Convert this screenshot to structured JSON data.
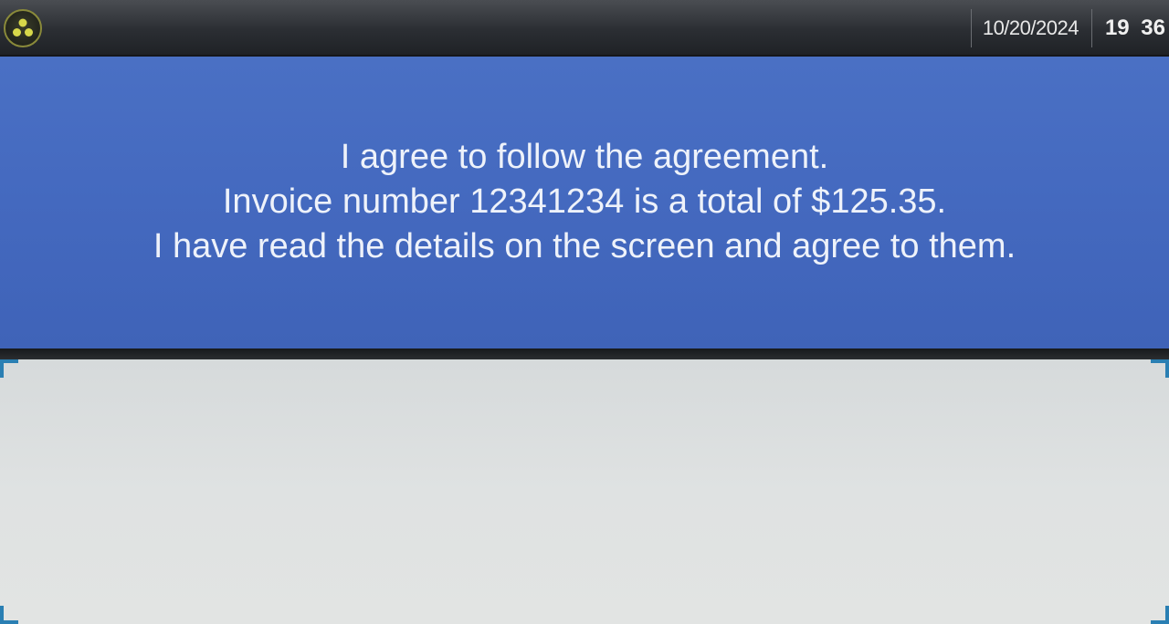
{
  "status_bar": {
    "logo_icon": "tri-dot-logo-icon",
    "date": "10/20/2024",
    "time": "19 36"
  },
  "message": {
    "lines": [
      "I agree to follow the agreement.",
      "Invoice number 12341234 is a total of $125.35.",
      "I have read the details on the screen and agree to them."
    ]
  },
  "colors": {
    "panel_blue": "#4469bf",
    "signature_bg": "#dfe2e2",
    "corner_marker": "#2a7fb3",
    "logo_dots": "#d8d84a"
  }
}
